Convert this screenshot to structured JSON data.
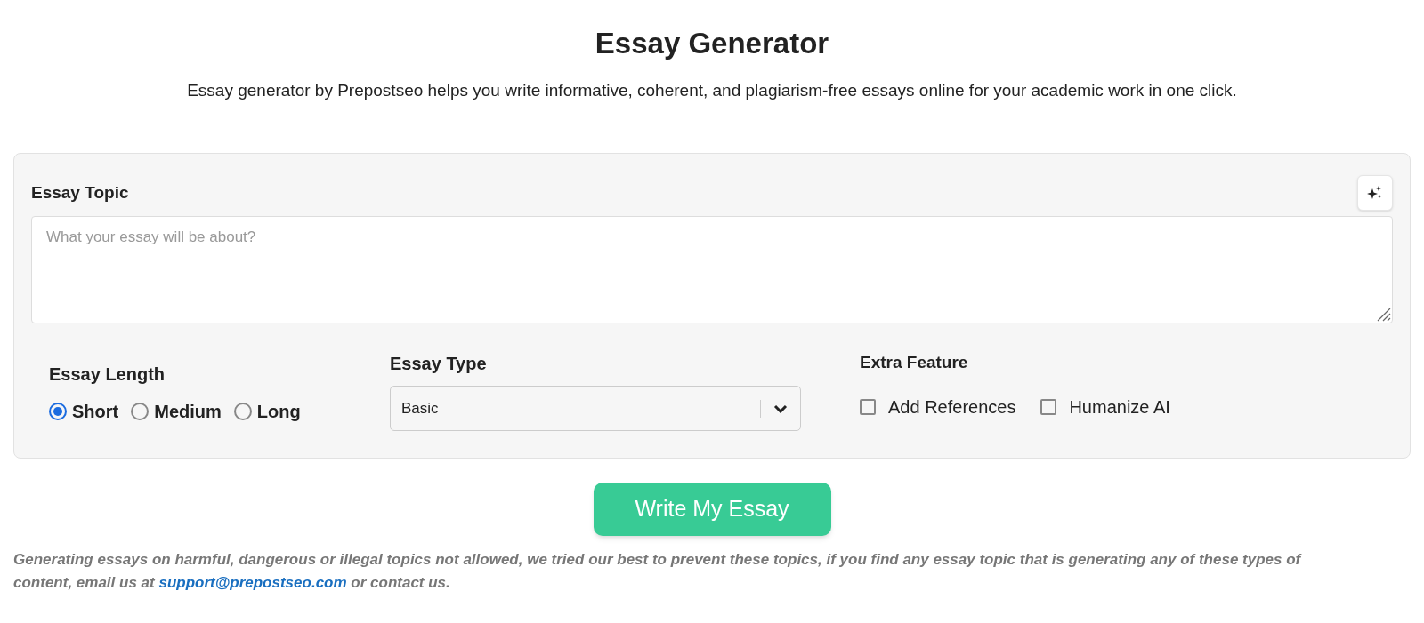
{
  "title": "Essay Generator",
  "subtitle": "Essay generator by Prepostseo helps you write informative, coherent, and plagiarism-free essays online for your academic work in one click.",
  "topic": {
    "label": "Essay Topic",
    "placeholder": "What your essay will be about?"
  },
  "length": {
    "label": "Essay Length",
    "options": [
      {
        "label": "Short",
        "selected": true
      },
      {
        "label": "Medium",
        "selected": false
      },
      {
        "label": "Long",
        "selected": false
      }
    ]
  },
  "type": {
    "label": "Essay Type",
    "value": "Basic"
  },
  "extra": {
    "label": "Extra Feature",
    "options": [
      {
        "label": "Add References",
        "checked": false
      },
      {
        "label": "Humanize AI",
        "checked": false
      }
    ]
  },
  "submit": "Write My Essay",
  "notice": {
    "before": "Generating essays on harmful, dangerous or illegal topics not allowed, we tried our best to prevent these topics, if you find any essay topic that is generating any of these types of content, email us at",
    "link": "support@prepostseo.com",
    "after": "or contact us."
  }
}
